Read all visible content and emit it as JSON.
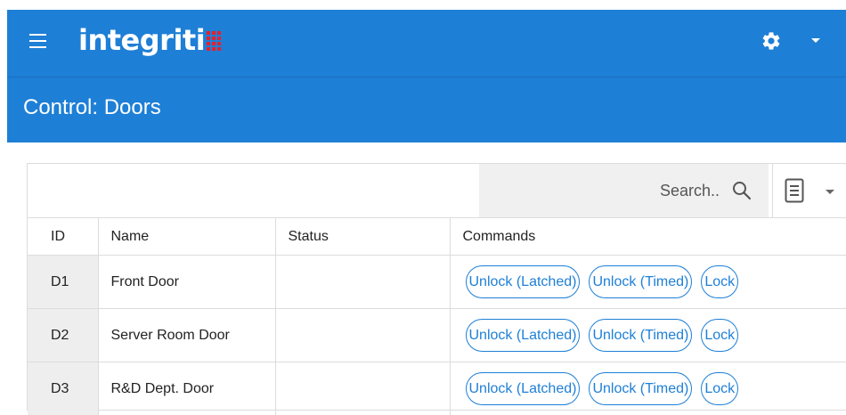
{
  "header": {
    "logo_text": "integriti",
    "menu_icon": "hamburger-menu-icon",
    "settings_icon": "gear-icon",
    "colors": {
      "primary": "#1e7fd6",
      "logo_mark": "#e8202a"
    }
  },
  "page": {
    "title": "Control: Doors"
  },
  "toolbar": {
    "search_placeholder": "Search..",
    "search_icon": "search-icon",
    "view_icon": "list-view-icon"
  },
  "table": {
    "columns": [
      "ID",
      "Name",
      "Status",
      "Commands"
    ],
    "rows": [
      {
        "id": "D1",
        "name": "Front Door",
        "status": ""
      },
      {
        "id": "D2",
        "name": "Server Room Door",
        "status": ""
      },
      {
        "id": "D3",
        "name": "R&D Dept. Door",
        "status": ""
      }
    ],
    "commands": [
      "Unlock (Latched)",
      "Unlock (Timed)",
      "Lock"
    ]
  }
}
